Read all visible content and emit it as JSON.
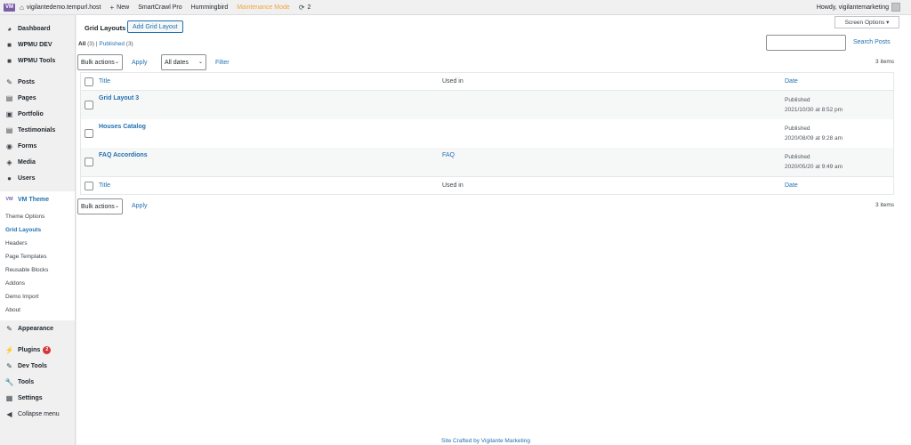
{
  "admin_bar": {
    "logo": "VM",
    "site": "vigilantedemo.tempurl.host",
    "new": "New",
    "items": [
      "SmartCrawl Pro",
      "Hummingbird"
    ],
    "maintenance": "Maintenance Mode",
    "updates": "2",
    "howdy": "Howdy, vigilantemarketing"
  },
  "sidebar": {
    "group1": [
      {
        "label": "Dashboard",
        "icon": "dashboard-icon",
        "glyph": "◕"
      },
      {
        "label": "WPMU DEV",
        "icon": "wpmu-icon",
        "glyph": "■"
      },
      {
        "label": "WPMU Tools",
        "icon": "tools-icon",
        "glyph": "■"
      }
    ],
    "group2": [
      {
        "label": "Posts",
        "icon": "pin-icon",
        "glyph": "✎"
      },
      {
        "label": "Pages",
        "icon": "pages-icon",
        "glyph": "▤"
      },
      {
        "label": "Portfolio",
        "icon": "portfolio-icon",
        "glyph": "▣"
      },
      {
        "label": "Testimonials",
        "icon": "testimonials-icon",
        "glyph": "▤"
      },
      {
        "label": "Forms",
        "icon": "forms-icon",
        "glyph": "◉"
      },
      {
        "label": "Media",
        "icon": "media-icon",
        "glyph": "◈"
      },
      {
        "label": "Users",
        "icon": "users-icon",
        "glyph": "●"
      }
    ],
    "current": {
      "label": "VM Theme",
      "glyph": "VM"
    },
    "submenu": [
      "Theme Options",
      "Grid Layouts",
      "Headers",
      "Page Templates",
      "Reusable Blocks",
      "Addons",
      "Demo Import",
      "About"
    ],
    "group3": [
      {
        "label": "Appearance",
        "icon": "appearance-icon",
        "glyph": "✎"
      }
    ],
    "plugins": {
      "label": "Plugins",
      "badge": "2"
    },
    "group4": [
      {
        "label": "Dev Tools",
        "icon": "devtools-icon",
        "glyph": "✎"
      },
      {
        "label": "Tools",
        "icon": "wrench-icon",
        "glyph": "🔧"
      },
      {
        "label": "Settings",
        "icon": "settings-icon",
        "glyph": "▦"
      },
      {
        "label": "Collapse menu",
        "icon": "collapse-icon",
        "glyph": "◀"
      }
    ]
  },
  "main": {
    "screen_options": "Screen Options ▾",
    "title": "Grid Layouts",
    "add_button": "Add Grid Layout",
    "views": {
      "all": "All",
      "all_count": "(3)",
      "sep": "|",
      "published": "Published",
      "published_count": "(3)"
    },
    "search_button": "Search Posts",
    "bulk_actions": "Bulk actions",
    "apply": "Apply",
    "all_dates": "All dates",
    "filter": "Filter",
    "items_count": "3 items",
    "columns": {
      "title": "Title",
      "used_in": "Used in",
      "date": "Date"
    },
    "rows": [
      {
        "title": "Grid Layout 3",
        "used_in": "",
        "status": "Published",
        "date": "2021/10/30 at 8:52 pm"
      },
      {
        "title": "Houses Catalog",
        "used_in": "",
        "status": "Published",
        "date": "2020/08/09 at 9:28 am"
      },
      {
        "title": "FAQ Accordions",
        "used_in": "FAQ",
        "status": "Published",
        "date": "2020/05/20 at 9:49 am"
      }
    ]
  },
  "footer": {
    "credit": "Site Crafted by Vigilante Marketing"
  }
}
